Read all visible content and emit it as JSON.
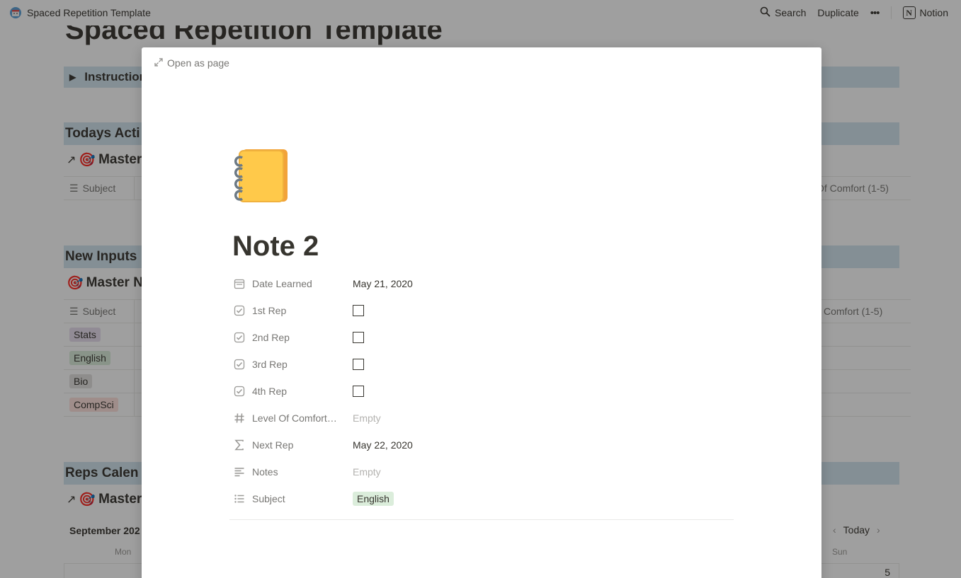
{
  "topbar": {
    "page_title": "Spaced Repetition Template",
    "search_label": "Search",
    "duplicate_label": "Duplicate",
    "more_label": "•••",
    "notion_label": "Notion"
  },
  "background": {
    "title": "Spaced Repetition Template",
    "instructions": "Instruction",
    "todays_heading": "Todays Acti",
    "master_db_1": "Master",
    "subject_col": "Subject",
    "comfort_col_1": "Of Comfort (1-5)",
    "new_inputs_heading": "New Inputs",
    "master_db_2": "Master N",
    "comfort_col_2": "Comfort (1-5)",
    "tags": [
      "Stats",
      "English",
      "Bio",
      "CompSci"
    ],
    "reps_heading": "Reps Calen",
    "master_db_3": "Master",
    "cal_month": "September 202",
    "today_label": "Today",
    "dow_mon": "Mon",
    "dow_sun": "Sun",
    "cal_day": "5"
  },
  "modal": {
    "open_as_page": "Open as page",
    "title": "Note 2",
    "icon": "notebook-icon",
    "properties": {
      "date_learned": {
        "name": "Date Learned",
        "value": "May 21, 2020"
      },
      "rep1": {
        "name": "1st Rep",
        "checked": false
      },
      "rep2": {
        "name": "2nd Rep",
        "checked": false
      },
      "rep3": {
        "name": "3rd Rep",
        "checked": false
      },
      "rep4": {
        "name": "4th Rep",
        "checked": false
      },
      "comfort": {
        "name": "Level Of Comfort…",
        "value": "Empty"
      },
      "next_rep": {
        "name": "Next Rep",
        "value": "May 22, 2020"
      },
      "notes": {
        "name": "Notes",
        "value": "Empty"
      },
      "subject": {
        "name": "Subject",
        "value": "English"
      }
    }
  },
  "colors": {
    "heading_bg": "#d3e5ef",
    "tag_stats": "#e8deee",
    "tag_english": "#dbeddb",
    "tag_bio": "#e3e2e0",
    "tag_compsci": "#ffe2dd"
  }
}
